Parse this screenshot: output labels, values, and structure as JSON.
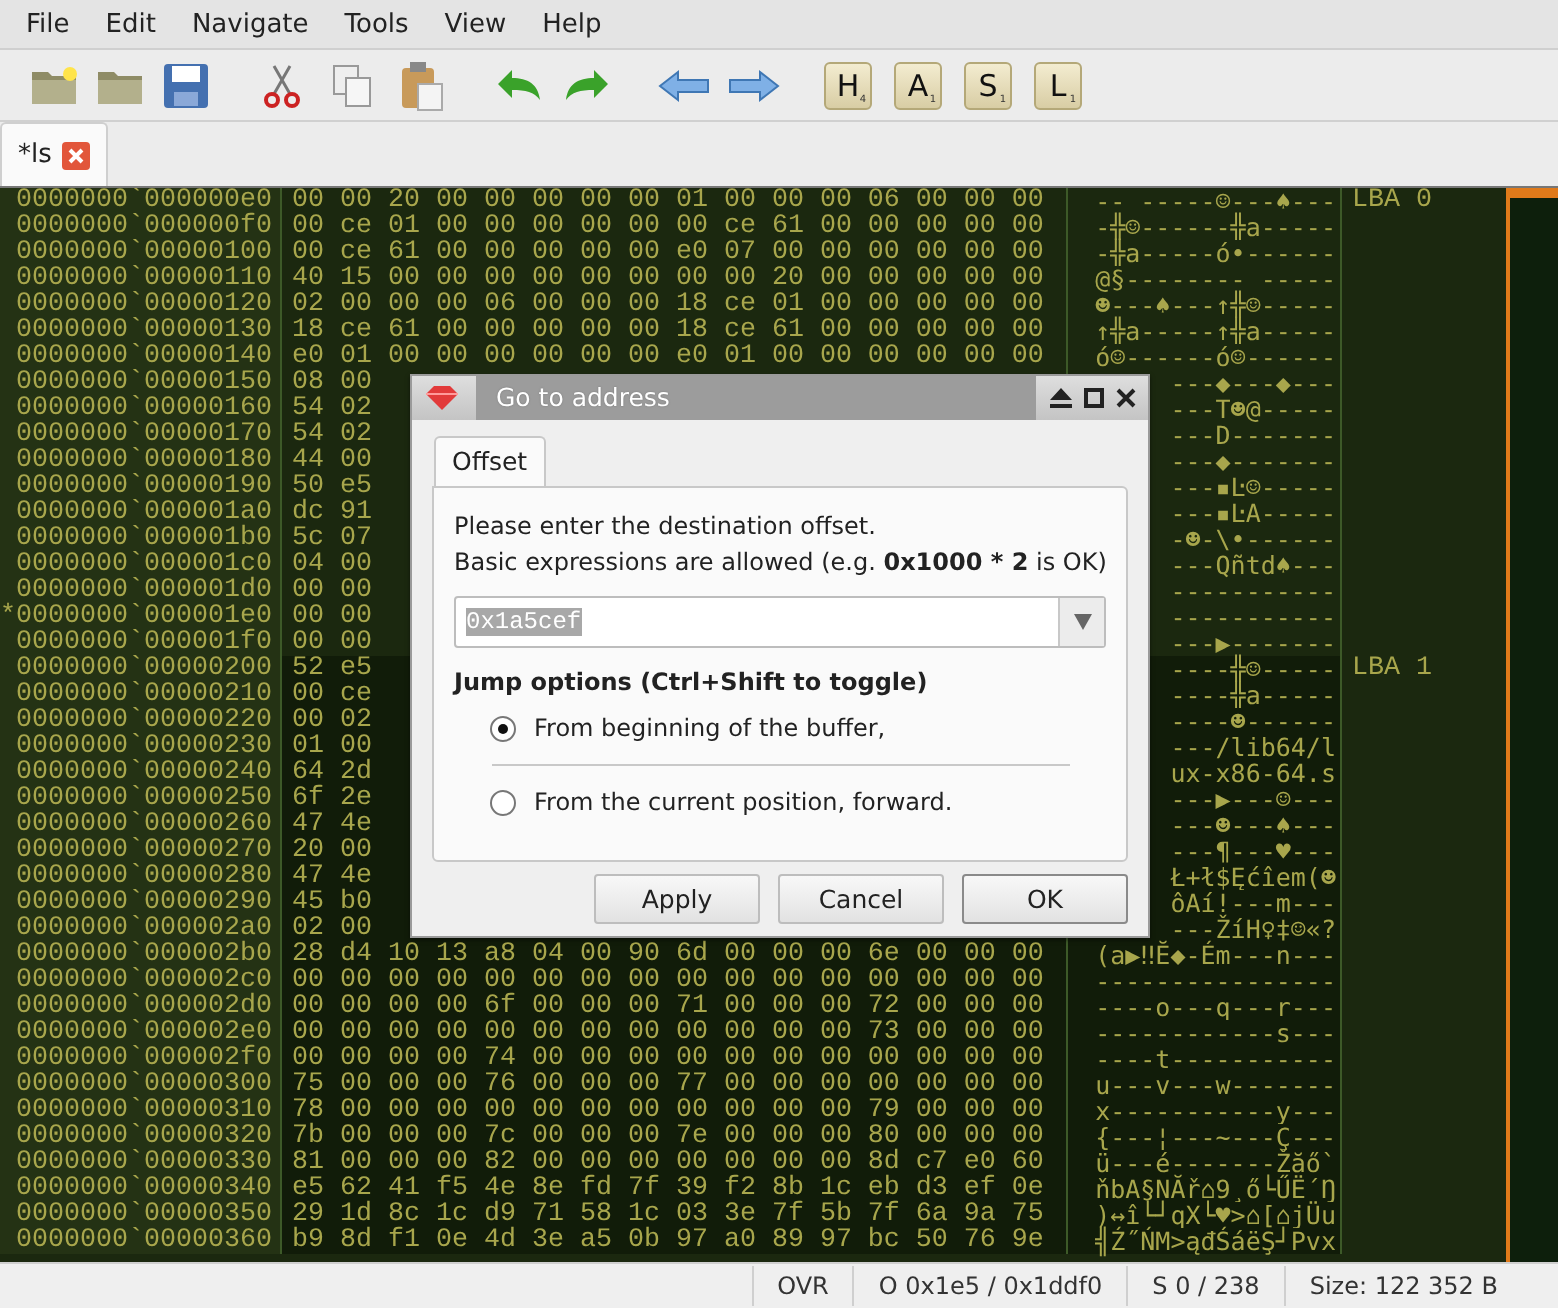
{
  "menu": [
    "File",
    "Edit",
    "Navigate",
    "Tools",
    "View",
    "Help"
  ],
  "tiles": [
    {
      "letter": "H",
      "points": "4"
    },
    {
      "letter": "A",
      "points": "1"
    },
    {
      "letter": "S",
      "points": "1"
    },
    {
      "letter": "L",
      "points": "1"
    }
  ],
  "tabs": [
    {
      "label": "*ls",
      "selected": true
    }
  ],
  "sectors": [
    {
      "label": "LBA 0",
      "rows": [
        {
          "address": "0000000`000000e0",
          "hex": "00 00 20 00 00 00 00 00 01 00 00 00 06 00 00 00",
          "ascii": "-- -----☺---♠---"
        },
        {
          "address": "0000000`000000f0",
          "hex": "00 ce 01 00 00 00 00 00 00 ce 61 00 00 00 00 00",
          "ascii": "-╬☺------╬a-----"
        },
        {
          "address": "0000000`00000100",
          "hex": "00 ce 61 00 00 00 00 00 e0 07 00 00 00 00 00 00",
          "ascii": "-╬a-----ó•------"
        },
        {
          "address": "0000000`00000110",
          "hex": "40 15 00 00 00 00 00 00 00 00 20 00 00 00 00 00",
          "ascii": "@§-------- -----"
        },
        {
          "address": "0000000`00000120",
          "hex": "02 00 00 00 06 00 00 00 18 ce 01 00 00 00 00 00",
          "ascii": "☻---♠---↑╬☺-----"
        },
        {
          "address": "0000000`00000130",
          "hex": "18 ce 61 00 00 00 00 00 18 ce 61 00 00 00 00 00",
          "ascii": "↑╬a-----↑╬a-----"
        },
        {
          "address": "0000000`00000140",
          "hex": "e0 01 00 00 00 00 00 00 e0 01 00 00 00 00 00 00",
          "ascii": "ó☺------ó☺------"
        },
        {
          "address": "0000000`00000150",
          "hex": "08 00",
          "ascii": "---◆---◆---"
        },
        {
          "address": "0000000`00000160",
          "hex": "54 02",
          "ascii": "---T☻@-----"
        },
        {
          "address": "0000000`00000170",
          "hex": "54 02",
          "ascii": "---D-------"
        },
        {
          "address": "0000000`00000180",
          "hex": "44 00",
          "ascii": "---◆-------"
        },
        {
          "address": "0000000`00000190",
          "hex": "50 e5",
          "ascii": "---▪Ŀ☺-----"
        },
        {
          "address": "0000000`000001a0",
          "hex": "dc 91",
          "ascii": "---▪ĿA-----"
        },
        {
          "address": "0000000`000001b0",
          "hex": "5c 07",
          "ascii": "-☻-\\•------"
        },
        {
          "address": "0000000`000001c0",
          "hex": "04 00",
          "ascii": "---Qñtd♠---"
        },
        {
          "address": "0000000`000001d0",
          "hex": "00 00",
          "ascii": "-----------"
        },
        {
          "mark": "*",
          "address": "0000000`000001e0",
          "hex": "00 00",
          "ascii": "-----------"
        },
        {
          "address": "0000000`000001f0",
          "hex": "00 00",
          "ascii": "---▶-------"
        }
      ]
    },
    {
      "label": "LBA 1",
      "rows": [
        {
          "address": "0000000`00000200",
          "hex": "52 e5",
          "ascii": "----╬☺-----"
        },
        {
          "address": "0000000`00000210",
          "hex": "00 ce",
          "ascii": "----╬a-----"
        },
        {
          "address": "0000000`00000220",
          "hex": "00 02",
          "ascii": "----☻------"
        },
        {
          "address": "0000000`00000230",
          "hex": "01 00",
          "ascii": "---/lib64/l"
        },
        {
          "address": "0000000`00000240",
          "hex": "64 2d",
          "ascii": "ux-x86-64.s"
        },
        {
          "address": "0000000`00000250",
          "hex": "6f 2e",
          "ascii": "---▶---☺---"
        },
        {
          "address": "0000000`00000260",
          "hex": "47 4e",
          "ascii": "---☻---♠---"
        },
        {
          "address": "0000000`00000270",
          "hex": "20 00",
          "ascii": "---¶---♥---"
        },
        {
          "address": "0000000`00000280",
          "hex": "47 4e",
          "ascii": "Ł+ł$Ęćîem(☻"
        },
        {
          "address": "0000000`00000290",
          "hex": "45 b0",
          "ascii": "ôAí!---m---"
        },
        {
          "address": "0000000`000002a0",
          "hex": "02 00",
          "ascii": "---ŽíH♀‡☺«?"
        },
        {
          "address": "0000000`000002b0",
          "hex": "28 d4 10 13 a8 04 00 90 6d 00 00 00 6e 00 00 00",
          "ascii": "(a▶‼Ĕ◆-Ém---n---"
        },
        {
          "address": "0000000`000002c0",
          "hex": "00 00 00 00 00 00 00 00 00 00 00 00 00 00 00 00",
          "ascii": "----------------"
        },
        {
          "address": "0000000`000002d0",
          "hex": "00 00 00 00 6f 00 00 00 71 00 00 00 72 00 00 00",
          "ascii": "----o---q---r---"
        },
        {
          "address": "0000000`000002e0",
          "hex": "00 00 00 00 00 00 00 00 00 00 00 00 73 00 00 00",
          "ascii": "------------s---"
        },
        {
          "address": "0000000`000002f0",
          "hex": "00 00 00 00 74 00 00 00 00 00 00 00 00 00 00 00",
          "ascii": "----t-----------"
        },
        {
          "address": "0000000`00000300",
          "hex": "75 00 00 00 76 00 00 00 77 00 00 00 00 00 00 00",
          "ascii": "u---v---w-------"
        },
        {
          "address": "0000000`00000310",
          "hex": "78 00 00 00 00 00 00 00 00 00 00 00 79 00 00 00",
          "ascii": "x-----------y---"
        },
        {
          "address": "0000000`00000320",
          "hex": "7b 00 00 00 7c 00 00 00 7e 00 00 00 80 00 00 00",
          "ascii": "{---¦---~---Ç---"
        },
        {
          "address": "0000000`00000330",
          "hex": "81 00 00 00 82 00 00 00 00 00 00 00 8d c7 e0 60",
          "ascii": "ü---é-------Žăő`"
        },
        {
          "address": "0000000`00000340",
          "hex": "e5 62 41 f5 4e 8e fd 7f 39 f2 8b 1c eb d3 ef 0e",
          "ascii": "ňbA§NĂř⌂9¸ő└ŰË´Ŋ"
        },
        {
          "address": "0000000`00000350",
          "hex": "29 1d 8c 1c d9 71 58 1c 03 3e 7f 5b 7f 6a 9a 75",
          "ascii": ")↔î└┘qX└♥>⌂[⌂jÜu"
        },
        {
          "address": "0000000`00000360",
          "hex": "b9 8d f1 0e 4d 3e a5 0b 97 a0 89 97 bc 50 76 9e",
          "ascii": "╣Ź˝ŃM>ąđŚáëŞ┘Pvx"
        }
      ]
    }
  ],
  "dialog": {
    "title": "Go to address",
    "tabs": [
      {
        "label": "Offset",
        "selected": true
      }
    ],
    "intro": "Please enter the destination offset.",
    "hint": "Basic expressions are allowed (e.g. **0x1000 * 2** is OK)",
    "value": "0x1a5cef",
    "options_title": "Jump options (Ctrl+Shift to toggle)",
    "options": [
      {
        "label": "From beginning of the buffer,",
        "selected": true
      },
      {
        "label": "From the current position, forward.",
        "selected": false
      }
    ],
    "buttons": [
      {
        "label": "Apply",
        "default": false
      },
      {
        "label": "Cancel",
        "default": false
      },
      {
        "label": "OK",
        "default": true
      }
    ]
  },
  "status": [
    "OVR",
    "O 0x1e5 / 0x1ddf0",
    "S 0 / 238",
    "Size: 122 352 B"
  ]
}
